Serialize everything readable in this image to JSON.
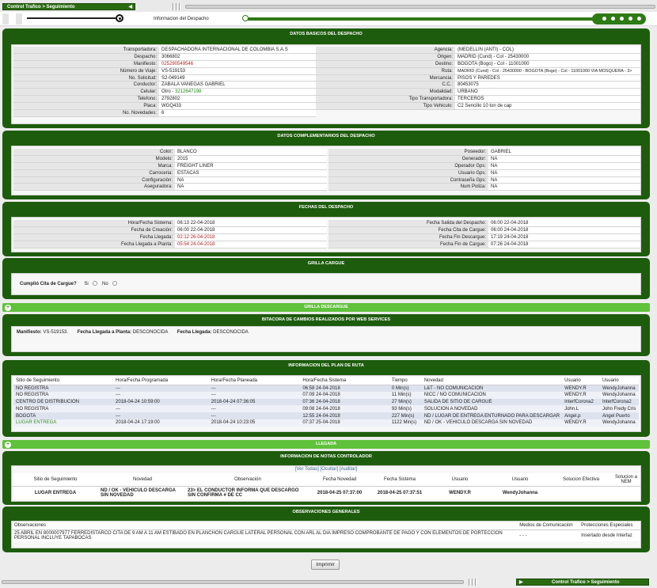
{
  "breadcrumb": "Control Trafico > Seguimiento",
  "step_title": "Informacion del Despacho",
  "basicos": {
    "title": "DATOS BASICOS DEL DESPACHO",
    "left": [
      {
        "label": "Transportadora:",
        "value": "DESPACHADORA INTERNACIONAL DE COLOMBIA S.A.S"
      },
      {
        "label": "Despacho:",
        "value": "3066802"
      },
      {
        "label": "Manifiesto:",
        "value": "025290549546"
      },
      {
        "label": "Número de Viaje:",
        "value": "VS-519153"
      },
      {
        "label": "No. Solicitud:",
        "value": "S2-049149"
      },
      {
        "label": "Conductor:",
        "value": "ZABALA VANEGAS GABRIEL"
      },
      {
        "label": "Celular:",
        "value": "Otro - ",
        "extra": "3212647198"
      },
      {
        "label": "Telefono:",
        "value": "2792802"
      },
      {
        "label": "Placa:",
        "value": "WGQ433"
      },
      {
        "label": "No. Novedades:",
        "value": "6"
      }
    ],
    "right": [
      {
        "label": "Agencia:",
        "value": "(MEDELLIN (ANTI) - COL)"
      },
      {
        "label": "Origen:",
        "value": "MADRID (Cund) - Col - 25430000"
      },
      {
        "label": "Destino:",
        "value": "BOGOTA (Bogo) - Col - 11001000"
      },
      {
        "label": "Ruta:",
        "value": "MADRID (Cund) - Col - 25430000 - BOGOTA (Bogo) - Col - 11001000 VIA MOSQUERA - 3>"
      },
      {
        "label": "Mercancia:",
        "value": "PISOS Y PAREDES"
      },
      {
        "label": "C.C.:",
        "value": "80453075"
      },
      {
        "label": "Modalidad:",
        "value": "URBANO"
      },
      {
        "label": "Tipo Transportadora:",
        "value": "TERCEROS"
      },
      {
        "label": "Tipo Vehiculo:",
        "value": "C2 Sencillo 10 ton de cap"
      }
    ]
  },
  "complementarios": {
    "title": "DATOS COMPLEMENTARIOS DEL DESPACHO",
    "left": [
      {
        "label": "Color:",
        "value": "BLANCO"
      },
      {
        "label": "Modelo:",
        "value": "2015"
      },
      {
        "label": "Marca:",
        "value": "FREIGHT LINER"
      },
      {
        "label": "Carroceria:",
        "value": "ESTACAS"
      },
      {
        "label": "Configuración:",
        "value": "NA"
      },
      {
        "label": "Aseguradora:",
        "value": "NA"
      }
    ],
    "right": [
      {
        "label": "Poseedor:",
        "value": "GABRIEL"
      },
      {
        "label": "Generador:",
        "value": "NA"
      },
      {
        "label": "Operador Gps:",
        "value": "NA"
      },
      {
        "label": "Usuario Gps:",
        "value": "NA"
      },
      {
        "label": "Contraseña Gps:",
        "value": "NA"
      },
      {
        "label": "Num Poliza:",
        "value": "NA"
      }
    ]
  },
  "fechas": {
    "title": "FECHAS DEL DESPACHO",
    "left": [
      {
        "label": "Hora/Fecha Sistema:",
        "value": "06:13 22-04-2018"
      },
      {
        "label": "Fecha de Creación:",
        "value": "06:00 22-04-2018"
      },
      {
        "label": "Fecha Llegada:",
        "value": "02:12 26-04-2018",
        "red": true
      },
      {
        "label": "Fecha Llegada a Planta:",
        "value": "05:54 24-04-2018",
        "red": true
      }
    ],
    "right": [
      {
        "label": "Fecha Salida del Despacho:",
        "value": "06:00 22-04-2018"
      },
      {
        "label": "Fecha Cita de Cargue:",
        "value": "06:00 24-04-2018"
      },
      {
        "label": "Fecha Fin Descargue:",
        "value": "17:19 24-04-2018"
      },
      {
        "label": "Fecha Fin de Cargue:",
        "value": "07:26 24-04-2018"
      }
    ]
  },
  "grilla_cargue": {
    "title": "GRILLA CARGUE",
    "question": "Cumplió Cita de Cargue?",
    "si": "Si",
    "no": "No"
  },
  "grilla_descargue": {
    "title": "GRILLA DESCARGUE"
  },
  "bitacora": {
    "title": "BITACORA DE CAMBIOS REALIZADOS POR WEB SERVICES",
    "manifiesto_label": "Manifiesto:",
    "manifiesto": "VS-519153.",
    "planta_label": "Fecha Llegada a Planta:",
    "planta": "DESCONOCIDA",
    "llegada_label": "Fecha Llegada:",
    "llegada": "DESCONOCIDA"
  },
  "plan_ruta": {
    "title": "INFORMACION DEL PLAN DE RUTA",
    "headers": [
      "Sitio de Seguimiento",
      "Hora/Fecha Programada",
      "Hora/Fecha Planeada",
      "Hora/Fecha Sistema",
      "Tiempo",
      "Novedad",
      "Usuario",
      "Usuario"
    ],
    "rows": [
      [
        "NO REGISTRA",
        "---",
        "---",
        "06:58 24-04-2018",
        "0 Min(s)",
        "L&T - NO COMUNICACION",
        "WENDY.R",
        "WendyJohanna"
      ],
      [
        "NO REGISTRA",
        "---",
        "---",
        "07:09 24-04-2018",
        "11 Min(s)",
        "NICC / NO COMUNICACION",
        "WENDY.R",
        "WendyJohanna"
      ],
      [
        "CENTRO DE DISTRIBUCIÓN",
        "2018-04-24 10:59:00",
        "2018-04-24 07:36:05",
        "07:36 24-04-2018",
        "27 Min(s)",
        "SALIDA DE SITIO DE CARGUE",
        "InterfCorona2",
        "InterfCorona2"
      ],
      [
        "NO REGISTRA",
        "---",
        "---",
        "09:08 24-04-2018",
        "93 Min(s)",
        "SOLUCION A NOVEDAD",
        "John.L",
        "John Fredy Cris"
      ],
      [
        "BOGOTA",
        "---",
        "---",
        "12:55 24-04-2018",
        "227 Min(s)",
        "ND / LUGAR DE ENTREGA ENTURNADO PARA DESCARGAR",
        "Angel.p",
        "Angel Puerto"
      ],
      [
        "LUGAR ENTREGA",
        "2018-04-24 17:19:00",
        "2018-04-24 10:23:05",
        "07:37 25-04-2018",
        "1122 Min(s)",
        "ND / OK - VEHICULO DESCARGA SIN NOVEDAD",
        "WENDY.R",
        "WendyJohanna"
      ]
    ]
  },
  "llegada": {
    "title": "LLEGADA"
  },
  "notas": {
    "title": "INFORMACION DE NOTAS CONTROLADOR",
    "ver_todas": "[Ver Todas]",
    "ocultar": "[Ocultar]",
    "auditar": "[Auditar]",
    "headers": [
      "Sitio de Seguimiento",
      "Novedad",
      "Observación",
      "Fecha Novedad",
      "Fecha Sistema",
      "Usuario",
      "Usuario",
      "Solucion Efectiva",
      "Solucion a NEM"
    ],
    "row": [
      "LUGAR ENTREGA",
      "ND / OK - VEHICULO DESCARGA SIN NOVEDAD",
      "23> EL CONDUCTOR INFORMA QUE DESCARGO SIN CONFIRMA # DE CC",
      "2018-04-25 07:37:00",
      "2018-04-25 07:37:51",
      "WENDY.R",
      "WendyJohanna",
      "",
      ""
    ]
  },
  "observaciones": {
    "title": "OBSERVACIONES GENERALES",
    "headers": [
      "Observaciones",
      "Medios de Comunicacion",
      "Protecciones Especiales"
    ],
    "row": [
      "25 ABRIL EN 8000007977 FERREDISTARCO CITA DE 9 AM A 11 AM ESTIBADO EN PLANCHON CARGUE LATERAL PERSONAL CON ARL AL DIA IMPRESO COMPROBANTE DE PAGO Y CON ELEMENTOS DE PORTECCION PERSONAL INCLUYE TAPABOCAS",
      "- - -",
      "Insertado desde Interfaz"
    ]
  },
  "print_button": "Imprimir",
  "footer_breadcrumb": "Control Trafico > Seguimiento"
}
